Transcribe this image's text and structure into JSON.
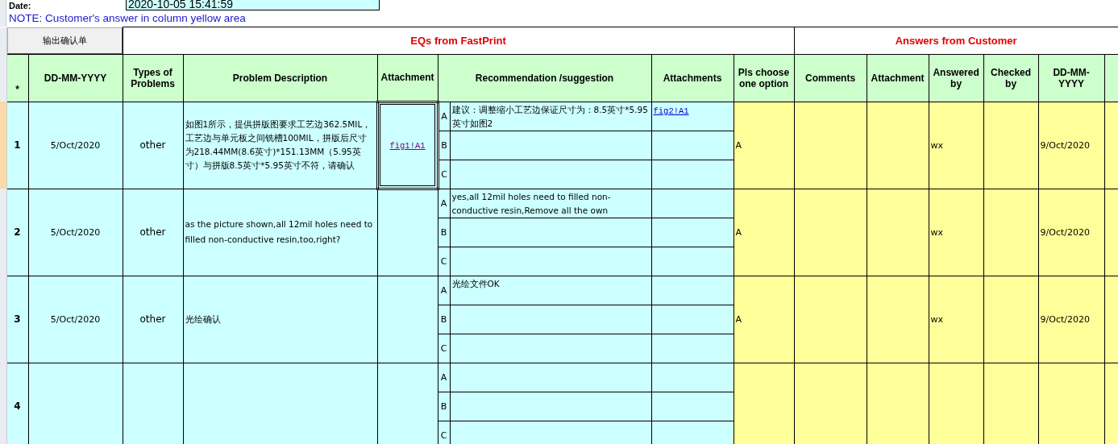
{
  "header": {
    "date_label": "Date:",
    "date_value": "2020-10-05 15:41:59",
    "note": "NOTE: Customer's  answer in column yellow area"
  },
  "export_button": "输出确认单",
  "group_headers": [
    "EQs from FastPrint",
    "Answers from Customer"
  ],
  "columns": [
    "*",
    "DD-MM-YYYY",
    "Types of Problems",
    "Problem Description",
    "Attachment",
    "Recommendation /suggestion",
    "Attachments",
    "Pls choose one option",
    "Comments",
    "Attachment",
    "Answered by",
    "Checked by",
    "DD-MM-YYYY"
  ],
  "rows": [
    {
      "number": "1",
      "date": "5/Oct/2020",
      "type": "other",
      "description": "如图1所示，提供拼版图要求工艺边362.5MIL，工艺边与单元板之间铣槽100MIL，拼版后尺寸为218.44MM(8.6英寸)*151.13MM（5.95英寸）与拼版8.5英寸*5.95英寸不符，请确认",
      "attachment": "fig1!A1",
      "attachment_selected": true,
      "options": [
        {
          "letter": "A",
          "text": "建议：调整缩小工艺边保证尺寸为：8.5英寸*5.95英寸如图2",
          "attachment": "fig2!A1"
        },
        {
          "letter": "B"
        },
        {
          "letter": "C"
        }
      ],
      "answer": {
        "option": "A",
        "answered_by": "wx",
        "date": "9/Oct/2020"
      }
    },
    {
      "number": "2",
      "date": "5/Oct/2020",
      "type": "other",
      "description": "as the picture shown,all 12mil holes need to filled non-conductive resin,too,right?",
      "attachment_selected": false,
      "options": [
        {
          "letter": "A",
          "text": "yes,all 12mil holes need to filled non-conductive resin,Remove all the own"
        },
        {
          "letter": "B"
        },
        {
          "letter": "C"
        }
      ],
      "answer": {
        "option": "A",
        "answered_by": "wx",
        "date": "9/Oct/2020"
      }
    },
    {
      "number": "3",
      "date": "5/Oct/2020",
      "type": "other",
      "description": "光绘确认",
      "attachment_selected": false,
      "options": [
        {
          "letter": "A",
          "text": "光绘文件OK"
        },
        {
          "letter": "B"
        },
        {
          "letter": "C"
        }
      ],
      "answer": {
        "option": "A",
        "answered_by": "wx",
        "date": "9/Oct/2020"
      }
    },
    {
      "number": "4",
      "attachment_selected": false,
      "options": [
        {
          "letter": "A"
        },
        {
          "letter": "B"
        },
        {
          "letter": "C"
        }
      ],
      "answer": {}
    }
  ]
}
